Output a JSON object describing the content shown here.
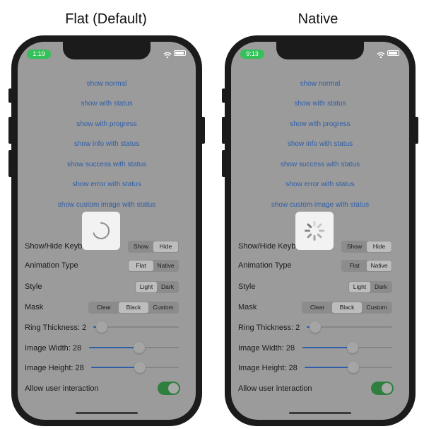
{
  "captions": {
    "left": "Flat (Default)",
    "right": "Native"
  },
  "colors": {
    "accent": "#2e5ea9",
    "toggle_on": "#2f7f3f",
    "status_pill": "#33c15a"
  },
  "phones": [
    {
      "time": "1:19",
      "hud_type": "flat-ring",
      "animation_selected": "Flat",
      "slider_values": {
        "ring_thickness": 2,
        "image_width": 28,
        "image_height": 28
      }
    },
    {
      "time": "9:13",
      "hud_type": "native-spinner",
      "animation_selected": "Native",
      "slider_values": {
        "ring_thickness": 2,
        "image_width": 28,
        "image_height": 28
      }
    }
  ],
  "links": [
    "show normal",
    "show with status",
    "show with progress",
    "show info with status",
    "show success with status",
    "show error with status",
    "show custom image with status"
  ],
  "keyboard": {
    "label": "Show/Hide Keyboard",
    "show": "Show",
    "hide": "Hide"
  },
  "animation": {
    "label": "Animation Type",
    "flat": "Flat",
    "native": "Native"
  },
  "style": {
    "label": "Style",
    "light": "Light",
    "dark": "Dark",
    "selected": "Light"
  },
  "mask": {
    "label": "Mask",
    "clear": "Clear",
    "black": "Black",
    "custom": "Custom",
    "selected": "Black"
  },
  "ring_thickness": {
    "label": "Ring Thickness: 2",
    "value": 2,
    "min": 0,
    "max": 20
  },
  "image_width": {
    "label": "Image Width: 28",
    "value": 28,
    "min": 0,
    "max": 50
  },
  "image_height": {
    "label": "Image Height: 28",
    "value": 28,
    "min": 0,
    "max": 50
  },
  "interaction": {
    "label": "Allow user interaction",
    "on": true
  }
}
